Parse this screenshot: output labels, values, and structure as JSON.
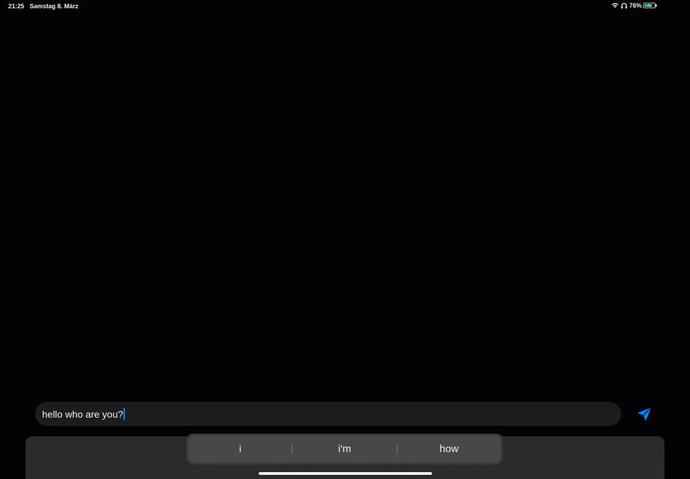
{
  "status_bar": {
    "time": "21:25",
    "date": "Samstag 8. März",
    "battery_text": "76%",
    "battery_level": 0.76,
    "icons": [
      "wifi-icon",
      "headphones-icon",
      "battery-charging-icon"
    ]
  },
  "input": {
    "value": "hello who are you?"
  },
  "send_button": {
    "icon": "send-paper-plane-icon",
    "color": "#0a84ff"
  },
  "predictive": {
    "suggestions": [
      "i",
      "i'm",
      "how"
    ]
  }
}
